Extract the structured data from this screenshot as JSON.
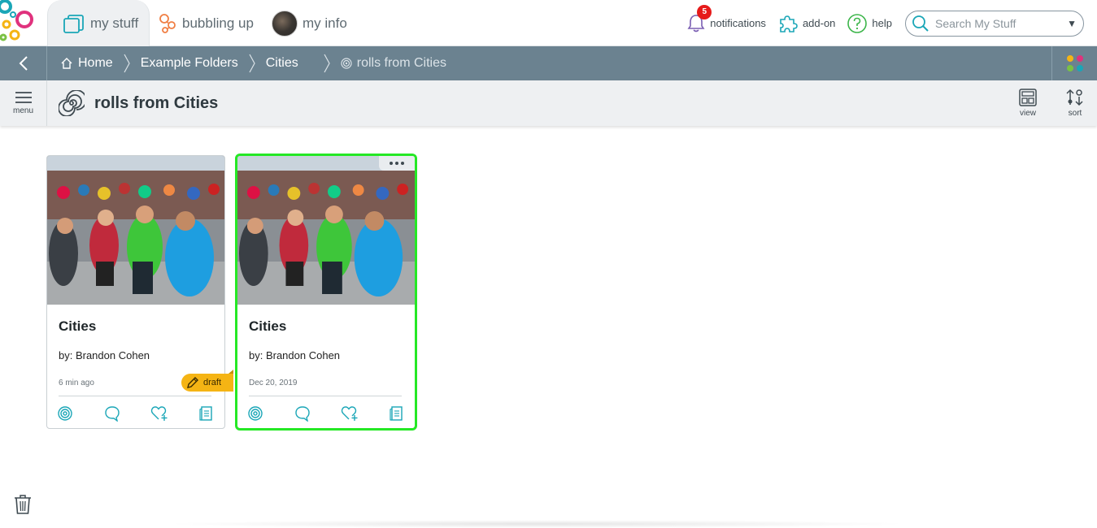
{
  "top_nav": {
    "tabs": [
      {
        "label": "my stuff",
        "icon": "folders-icon",
        "active": true
      },
      {
        "label": "bubbling up",
        "icon": "bubbles-icon"
      },
      {
        "label": "my info",
        "icon": "avatar"
      }
    ],
    "notifications": {
      "label": "notifications",
      "count": "5"
    },
    "addon": {
      "label": "add-on"
    },
    "help": {
      "label": "help"
    },
    "search": {
      "placeholder": "Search My Stuff"
    }
  },
  "breadcrumb": {
    "items": [
      "Home",
      "Example Folders",
      "Cities"
    ],
    "current": "rolls from Cities"
  },
  "title_bar": {
    "menu_label": "menu",
    "title": "rolls from Cities",
    "view_label": "view",
    "sort_label": "sort"
  },
  "cards": [
    {
      "title": "Cities",
      "author": "by: Brandon Cohen",
      "date": "6 min ago",
      "draft_label": "draft"
    },
    {
      "title": "Cities",
      "author": "by: Brandon Cohen",
      "date": "Dec 20, 2019"
    }
  ],
  "colors": {
    "accent_teal": "#1aa6b7",
    "breadcrumb_bg": "#6b8290",
    "draft": "#f5b414",
    "selected_border": "#25e825",
    "notification_badge": "#e61a1a"
  }
}
